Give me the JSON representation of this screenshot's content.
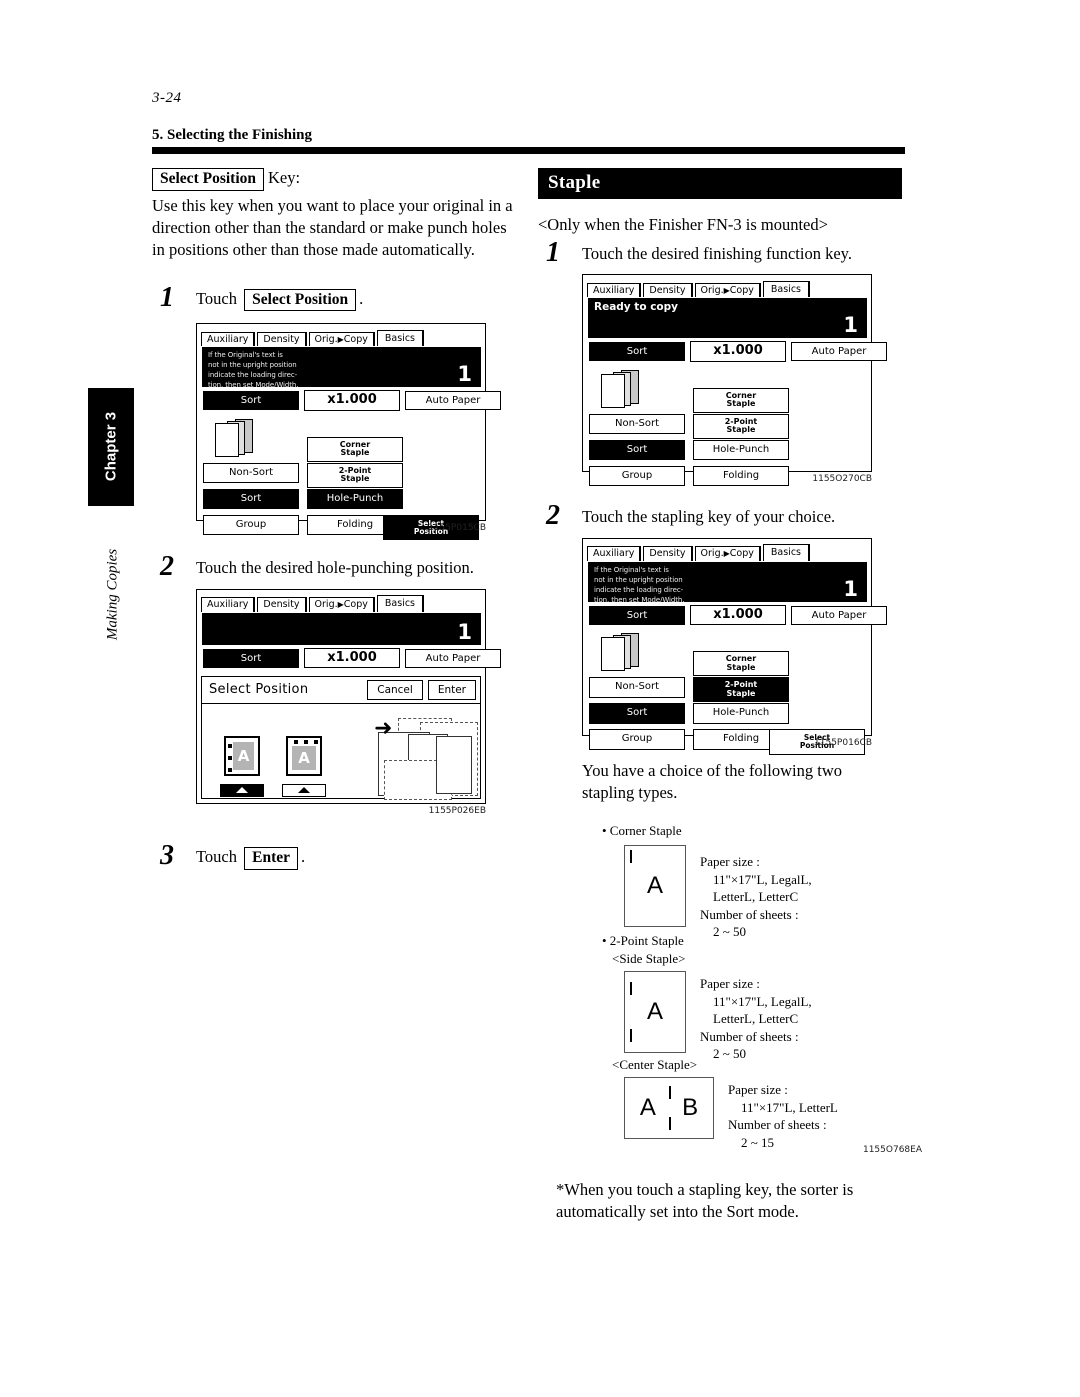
{
  "page": {
    "folio": "3-24",
    "section_title": "5. Selecting the Finishing",
    "chapter_tab": "Chapter 3",
    "chapter_subtitle": "Making Copies"
  },
  "left_column": {
    "key_name": "Select Position",
    "key_suffix": "Key:",
    "description": "Use this key when you want to place your original in a direction other than the standard or make punch holes in positions other than those made automatically.",
    "steps": [
      {
        "num": "1",
        "text_before": "Touch",
        "key": "Select Position",
        "text_after": "."
      },
      {
        "num": "2",
        "text": "Touch the desired hole-punching position."
      },
      {
        "num": "3",
        "text_before": "Touch",
        "key": "Enter",
        "text_after": "."
      }
    ],
    "figure1_ref": "1155P015CB",
    "figure2_ref": "1155P026EB"
  },
  "right_column": {
    "section_heading": "Staple",
    "note": "<Only when the Finisher FN-3 is mounted>",
    "steps": [
      {
        "num": "1",
        "text": "Touch the desired finishing function key."
      },
      {
        "num": "2",
        "text": "Touch the stapling key of your choice."
      }
    ],
    "figure1_ref": "1155O270CB",
    "figure2_ref": "1155P016CB",
    "figure3_ref": "1155O768EA",
    "choice_text": "You have a choice of the following two stapling types.",
    "footnote": "*When you touch a stapling key, the sorter is automatically set into the Sort mode."
  },
  "lcd_common": {
    "tabs": [
      "Auxiliary",
      "Density",
      "Orig.",
      "Copy",
      "Basics"
    ],
    "tab_arrow_glyph": "▶",
    "msg_direction": "If the Original's text is\nnot in the upright position\nindicate the loading direc-\ntion, then set Mode/Width.",
    "msg_ready": "Ready to copy",
    "msg_blank": "",
    "count": "1",
    "row_sort": "Sort",
    "row_zoom": "x1.000",
    "row_paper": "Auto Paper",
    "keys": {
      "non_sort": "Non-Sort",
      "sort": "Sort",
      "group": "Group",
      "corner_staple": "Corner\nStaple",
      "two_point_staple": "2-Point\nStaple",
      "hole_punch": "Hole-Punch",
      "folding": "Folding",
      "select_position": "Select\nPosition"
    },
    "select_position_dialog": {
      "title": "Select Position",
      "cancel": "Cancel",
      "enter": "Enter",
      "sheet_letter": "A"
    }
  },
  "lcd_states": {
    "screen1": {
      "message": "If the Original's text is\nnot in the upright position\nindicate the loading direc-\ntion, then set Mode/Width.",
      "message_style": "small",
      "selected_keys": [
        "sort",
        "hole_punch",
        "select_position"
      ],
      "has_select_position": true
    },
    "screen3": {
      "message": "Ready to copy",
      "message_style": "big",
      "selected_keys": [
        "sort"
      ],
      "has_select_position": false
    },
    "screen4": {
      "message": "If the Original's text is\nnot in the upright position\nindicate the loading direc-\ntion, then set Mode/Width.",
      "message_style": "small",
      "selected_keys": [
        "sort",
        "two_point_staple"
      ],
      "has_select_position": true
    }
  },
  "staple_types": [
    {
      "bullet": "• Corner Staple",
      "sub": "",
      "letter": "A",
      "marks": "corner",
      "paper_size_label": "Paper size :",
      "paper_size_value_1": "11\"×17\"L, LegalL,",
      "paper_size_value_2": "LetterL, LetterC",
      "sheets_label": "Number of sheets :",
      "sheets_value": "2 ~ 50"
    },
    {
      "bullet": "• 2-Point Staple",
      "sub": "<Side Staple>",
      "letter": "A",
      "marks": "side",
      "paper_size_label": "Paper size :",
      "paper_size_value_1": "11\"×17\"L, LegalL,",
      "paper_size_value_2": "LetterL, LetterC",
      "sheets_label": "Number of sheets :",
      "sheets_value": "2 ~ 50"
    },
    {
      "bullet": "",
      "sub": "<Center Staple>",
      "letter": "A",
      "letter2": "B",
      "marks": "center",
      "paper_size_label": "Paper size :",
      "paper_size_value_1": "11\"×17\"L, LetterL",
      "paper_size_value_2": "",
      "sheets_label": "Number of sheets :",
      "sheets_value": "2 ~ 15"
    }
  ],
  "colors": {
    "ink": "#000000",
    "paper": "#ffffff",
    "lcd_gray": "#b4b4b4"
  }
}
